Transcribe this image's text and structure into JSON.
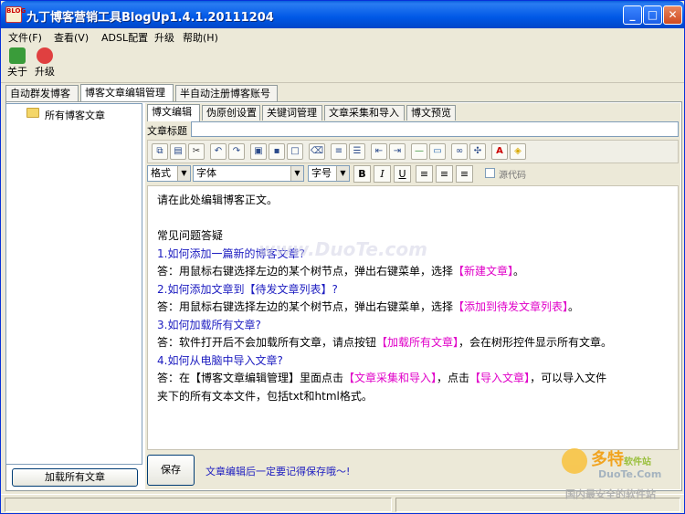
{
  "window": {
    "title": "九丁博客营销工具BlogUp1.4.1.20111204",
    "icon_text": "BLOG"
  },
  "menu": [
    "文件(F)",
    "查看(V)",
    "ADSL配置",
    "升级",
    "帮助(H)"
  ],
  "toolbar": {
    "about_label": "关于",
    "upgrade_label": "升级"
  },
  "main_tabs": [
    "自动群发博客",
    "博客文章编辑管理",
    "半自动注册博客账号"
  ],
  "tree": {
    "root_label": "所有博客文章"
  },
  "load_all_button": "加载所有文章",
  "sub_tabs": [
    "博文编辑",
    "伪原创设置",
    "关键词管理",
    "文章采集和导入",
    "博文预览"
  ],
  "title_label": "文章标题",
  "format_bar": {
    "format_select": "格式",
    "font_select": "字体",
    "size_select": "字号",
    "bold": "B",
    "italic": "I",
    "underline": "U",
    "source_label": "源代码"
  },
  "editor": {
    "intro": "请在此处编辑博客正文。",
    "faq_heading": "常见问题答疑",
    "q1": "1.如何添加一篇新的博客文章?",
    "a1_pre": "答：用鼠标右键选择左边的某个树节点，弹出右键菜单，选择",
    "a1_hl": "【新建文章】",
    "a1_post": "。",
    "q2": "2.如何添加文章到【待发文章列表】?",
    "a2_pre": "答：用鼠标右键选择左边的某个树节点，弹出右键菜单，选择",
    "a2_hl": "【添加到待发文章列表】",
    "a2_post": "。",
    "q3": "3.如何加载所有文章?",
    "a3_pre": "答：软件打开后不会加载所有文章，请点按钮",
    "a3_hl": "【加载所有文章】",
    "a3_post": "，会在树形控件显示所有文章。",
    "q4": "4.如何从电脑中导入文章?",
    "a4_pre1": "答：在【博客文章编辑管理】里面点击",
    "a4_hl1": "【文章采集和导入】",
    "a4_mid": "，点击",
    "a4_hl2": "【导入文章】",
    "a4_post": "，可以导入文件",
    "a4_line2": "夹下的所有文本文件，包括txt和html格式。"
  },
  "save_button": "保存",
  "save_tip": "文章编辑后一定要记得保存哦～!",
  "watermark": {
    "center": "www.DuoTe.com",
    "brand": "多特",
    "brand_suffix": "软件站",
    "url": "DuoTe.Com",
    "slogan": "国内最安全的软件站"
  },
  "colors": {
    "question": "#1c1cc0",
    "highlight": "#e000c8",
    "titlebar": "#0058e6"
  }
}
